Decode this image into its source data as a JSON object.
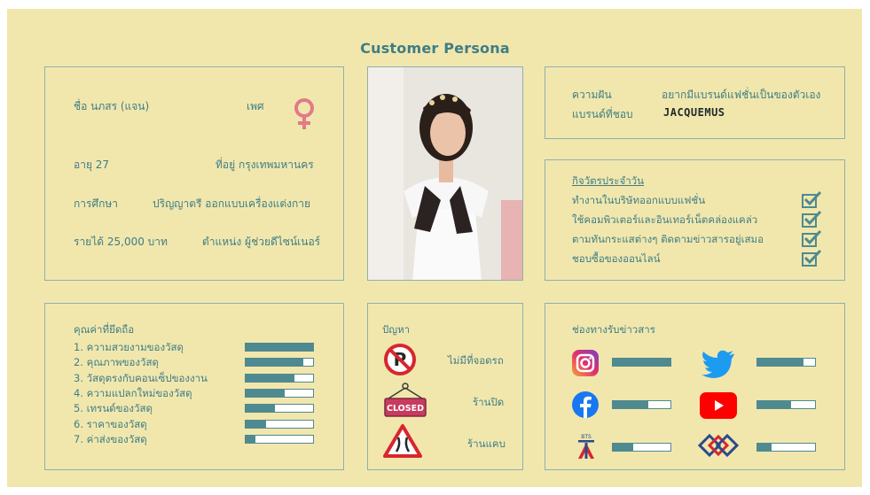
{
  "page": {
    "title": "Customer Persona"
  },
  "profile": {
    "name": "ชื่อ นภสร (แจน)",
    "gender_label": "เพศ",
    "age": "อายุ 27",
    "address": "ที่อยู่ กรุงเทพมหานคร",
    "education_label": "การศึกษา",
    "education_value": "ปริญญาตรี ออกแบบเครื่องแต่งกาย",
    "income": "รายได้ 25,000 บาท",
    "position": "ตำแหน่ง ผู้ช่วยดีไซน์เนอร์"
  },
  "dream": {
    "dream_label": "ความฝัน",
    "dream_value": "อยากมีแบรนด์แฟชั่นเป็นของตัวเอง",
    "brand_label": "แบรนด์ที่ชอบ",
    "brand_value": "JACQUEMUS"
  },
  "routine": {
    "title": "กิจวัตรประจำวัน",
    "items": [
      "ทำงานในบริษัทออกแบบแฟชั่น",
      "ใช้คอมพิวเตอร์และอินเทอร์เน็ตคล่องแคล่ว",
      "ตามทันกระแสต่างๆ ติดตามข่าวสารอยู่เสมอ",
      "ชอบซื้อของออนไลน์"
    ]
  },
  "values": {
    "title": "คุณค่าที่ยึดถือ",
    "items": [
      {
        "label": "1. ความสวยงามของวัสดุ",
        "level": 1.0
      },
      {
        "label": "2. คุณภาพของวัสดุ",
        "level": 0.86
      },
      {
        "label": "3. วัสดุตรงกับคอนเซ็ปของงาน",
        "level": 0.72
      },
      {
        "label": "4. ความแปลกใหม่ของวัสดุ",
        "level": 0.58
      },
      {
        "label": "5. เทรนด์ของวัสดุ",
        "level": 0.44
      },
      {
        "label": "6. ราคาของวัสดุ",
        "level": 0.3
      },
      {
        "label": "7. ค่าส่งของวัสดุ",
        "level": 0.15
      }
    ]
  },
  "problems": {
    "title": "ปัญหา",
    "items": [
      {
        "label": "ไม่มีที่จอดรถ",
        "icon": "no-parking-icon"
      },
      {
        "label": "ร้านปิด",
        "icon": "closed-sign-icon",
        "sign_text": "CLOSED"
      },
      {
        "label": "ร้านแคบ",
        "icon": "narrow-road-icon"
      }
    ]
  },
  "channels": {
    "title": "ช่องทางรับข่าวสาร",
    "items": [
      {
        "name": "Instagram",
        "icon": "instagram-icon",
        "level": 1.0
      },
      {
        "name": "Twitter",
        "icon": "twitter-icon",
        "level": 0.8
      },
      {
        "name": "Facebook",
        "icon": "facebook-icon",
        "level": 0.62
      },
      {
        "name": "YouTube",
        "icon": "youtube-icon",
        "level": 0.58
      },
      {
        "name": "BTS",
        "icon": "bts-icon",
        "bts_text": "BTS",
        "level": 0.35
      },
      {
        "name": "MRT",
        "icon": "mrt-icon",
        "level": 0.25
      }
    ]
  },
  "colors": {
    "accent": "#3f7d86",
    "background": "#f1e7ad",
    "bar": "#4f8a90",
    "female": "#e27a8a"
  }
}
